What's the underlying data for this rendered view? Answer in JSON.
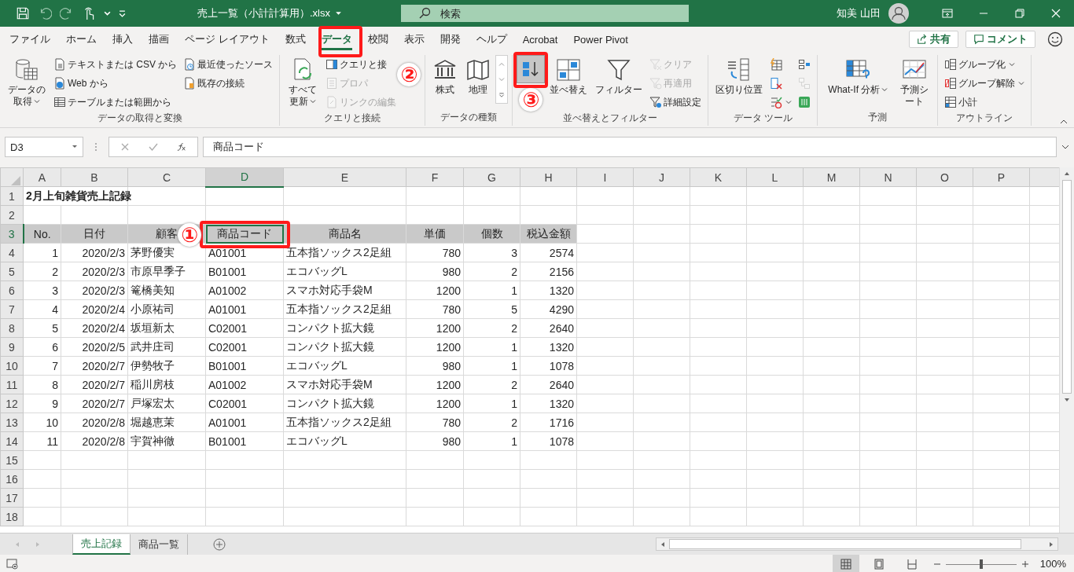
{
  "title_bar": {
    "file_name": "売上一覧（小計計算用）.xlsx",
    "search": {
      "placeholder": "検索"
    },
    "user_name": "知美 山田"
  },
  "menu_tabs": [
    {
      "label": "ファイル",
      "selected": false
    },
    {
      "label": "ホーム",
      "selected": false
    },
    {
      "label": "挿入",
      "selected": false
    },
    {
      "label": "描画",
      "selected": false
    },
    {
      "label": "ページ レイアウト",
      "selected": false
    },
    {
      "label": "数式",
      "selected": false
    },
    {
      "label": "データ",
      "selected": true
    },
    {
      "label": "校閲",
      "selected": false
    },
    {
      "label": "表示",
      "selected": false
    },
    {
      "label": "開発",
      "selected": false
    },
    {
      "label": "ヘルプ",
      "selected": false
    },
    {
      "label": "Acrobat",
      "selected": false
    },
    {
      "label": "Power Pivot",
      "selected": false
    }
  ],
  "share_button": "共有",
  "comment_button": "コメント",
  "ribbon_groups": [
    {
      "name": "データの取得と変換",
      "items": [
        {
          "label": "データの取得",
          "kind": "large",
          "dropdown": true,
          "disabled": false,
          "highlighted": false
        },
        {
          "label": "テキストまたは CSV から",
          "kind": "small",
          "dropdown": false,
          "disabled": false,
          "highlighted": false
        },
        {
          "label": "Web から",
          "kind": "small",
          "dropdown": false,
          "disabled": false,
          "highlighted": false
        },
        {
          "label": "テーブルまたは範囲から",
          "kind": "small",
          "dropdown": false,
          "disabled": false,
          "highlighted": false
        },
        {
          "label": "最近使ったソース",
          "kind": "small",
          "dropdown": false,
          "disabled": false,
          "highlighted": false
        },
        {
          "label": "既存の接続",
          "kind": "small",
          "dropdown": false,
          "disabled": false,
          "highlighted": false
        }
      ]
    },
    {
      "name": "クエリと接続",
      "items": [
        {
          "label": "すべて更新",
          "kind": "large",
          "dropdown": true,
          "disabled": false,
          "highlighted": false
        },
        {
          "label": "クエリと接",
          "kind": "small",
          "dropdown": false,
          "disabled": false,
          "highlighted": false
        },
        {
          "label": "プロパ",
          "kind": "small",
          "dropdown": false,
          "disabled": true,
          "highlighted": false
        },
        {
          "label": "リンクの編集",
          "kind": "small",
          "dropdown": false,
          "disabled": true,
          "highlighted": false
        }
      ]
    },
    {
      "name": "データの種類",
      "items": [
        {
          "label": "株式",
          "kind": "large",
          "dropdown": false,
          "disabled": false,
          "highlighted": false
        },
        {
          "label": "地理",
          "kind": "large",
          "dropdown": false,
          "disabled": false,
          "highlighted": false
        }
      ]
    },
    {
      "name": "並べ替えとフィルター",
      "items": [
        {
          "kind": "icon",
          "dropdown": false,
          "disabled": false,
          "highlighted": true
        },
        {
          "label": "並べ替え",
          "kind": "large",
          "dropdown": false,
          "disabled": false,
          "highlighted": false
        },
        {
          "label": "フィルター",
          "kind": "large",
          "dropdown": false,
          "disabled": false,
          "highlighted": false
        },
        {
          "label": "クリア",
          "kind": "small",
          "dropdown": false,
          "disabled": true,
          "highlighted": false
        },
        {
          "label": "再適用",
          "kind": "small",
          "dropdown": false,
          "disabled": true,
          "highlighted": false
        },
        {
          "label": "詳細設定",
          "kind": "small",
          "dropdown": false,
          "disabled": false,
          "highlighted": false
        }
      ]
    },
    {
      "name": "データ ツール",
      "items": [
        {
          "label": "区切り位置",
          "kind": "large",
          "dropdown": false,
          "disabled": false,
          "highlighted": false
        },
        {
          "kind": "icon",
          "dropdown": false,
          "disabled": false,
          "highlighted": false
        },
        {
          "kind": "icon",
          "dropdown": false,
          "disabled": false,
          "highlighted": false
        },
        {
          "kind": "icon",
          "dropdown": true,
          "disabled": false,
          "highlighted": false
        },
        {
          "kind": "icon",
          "dropdown": false,
          "disabled": false,
          "highlighted": false
        },
        {
          "kind": "icon",
          "dropdown": false,
          "disabled": true,
          "highlighted": false
        },
        {
          "kind": "icon",
          "dropdown": false,
          "disabled": false,
          "highlighted": false
        }
      ]
    },
    {
      "name": "予測",
      "items": [
        {
          "label": "What-If 分析",
          "kind": "large",
          "dropdown": true,
          "disabled": false,
          "highlighted": false
        },
        {
          "label": "予測シート",
          "kind": "large",
          "dropdown": false,
          "disabled": false,
          "highlighted": false
        }
      ]
    },
    {
      "name": "アウトライン",
      "items": [
        {
          "label": "グループ化",
          "kind": "small",
          "dropdown": true,
          "disabled": false,
          "highlighted": false
        },
        {
          "label": "グループ解除",
          "kind": "small",
          "dropdown": true,
          "disabled": false,
          "highlighted": false
        },
        {
          "label": "小計",
          "kind": "small",
          "dropdown": false,
          "disabled": false,
          "highlighted": false
        }
      ]
    }
  ],
  "formula_bar": {
    "name_box": "D3",
    "formula": "商品コード"
  },
  "sheet": {
    "columns": [
      {
        "label": "A",
        "selected": false
      },
      {
        "label": "B",
        "selected": false
      },
      {
        "label": "C",
        "selected": false
      },
      {
        "label": "D",
        "selected": true
      },
      {
        "label": "E",
        "selected": false
      },
      {
        "label": "F",
        "selected": false
      },
      {
        "label": "G",
        "selected": false
      },
      {
        "label": "H",
        "selected": false
      },
      {
        "label": "I",
        "selected": false
      },
      {
        "label": "J",
        "selected": false
      },
      {
        "label": "K",
        "selected": false
      },
      {
        "label": "L",
        "selected": false
      },
      {
        "label": "M",
        "selected": false
      },
      {
        "label": "N",
        "selected": false
      },
      {
        "label": "O",
        "selected": false
      },
      {
        "label": "P",
        "selected": false
      }
    ],
    "rows": [
      {
        "number": "1",
        "kind": "title",
        "selected": false,
        "cells": [
          "2月上旬雑貨売上記録"
        ]
      },
      {
        "number": "2",
        "kind": "empty",
        "selected": false,
        "cells": []
      },
      {
        "number": "3",
        "kind": "header",
        "selected": true,
        "cells": [
          "No.",
          "日付",
          "顧客",
          "商品コード",
          "商品名",
          "単価",
          "個数",
          "税込金額"
        ]
      },
      {
        "number": "4",
        "kind": "data",
        "selected": false,
        "cells": [
          "1",
          "2020/2/3",
          "茅野優実",
          "A01001",
          "五本指ソックス2足組",
          "780",
          "3",
          "2574"
        ]
      },
      {
        "number": "5",
        "kind": "data",
        "selected": false,
        "cells": [
          "2",
          "2020/2/3",
          "市原早季子",
          "B01001",
          "エコバッグL",
          "980",
          "2",
          "2156"
        ]
      },
      {
        "number": "6",
        "kind": "data",
        "selected": false,
        "cells": [
          "3",
          "2020/2/3",
          "篭橋美知",
          "A01002",
          "スマホ対応手袋M",
          "1200",
          "1",
          "1320"
        ]
      },
      {
        "number": "7",
        "kind": "data",
        "selected": false,
        "cells": [
          "4",
          "2020/2/4",
          "小原祐司",
          "A01001",
          "五本指ソックス2足組",
          "780",
          "5",
          "4290"
        ]
      },
      {
        "number": "8",
        "kind": "data",
        "selected": false,
        "cells": [
          "5",
          "2020/2/4",
          "坂垣新太",
          "C02001",
          "コンパクト拡大鏡",
          "1200",
          "2",
          "2640"
        ]
      },
      {
        "number": "9",
        "kind": "data",
        "selected": false,
        "cells": [
          "6",
          "2020/2/5",
          "武井庄司",
          "C02001",
          "コンパクト拡大鏡",
          "1200",
          "1",
          "1320"
        ]
      },
      {
        "number": "10",
        "kind": "data",
        "selected": false,
        "cells": [
          "7",
          "2020/2/7",
          "伊勢牧子",
          "B01001",
          "エコバッグL",
          "980",
          "1",
          "1078"
        ]
      },
      {
        "number": "11",
        "kind": "data",
        "selected": false,
        "cells": [
          "8",
          "2020/2/7",
          "稲川房枝",
          "A01002",
          "スマホ対応手袋M",
          "1200",
          "2",
          "2640"
        ]
      },
      {
        "number": "12",
        "kind": "data",
        "selected": false,
        "cells": [
          "9",
          "2020/2/7",
          "戸塚宏太",
          "C02001",
          "コンパクト拡大鏡",
          "1200",
          "1",
          "1320"
        ]
      },
      {
        "number": "13",
        "kind": "data",
        "selected": false,
        "cells": [
          "10",
          "2020/2/8",
          "堀越恵茉",
          "A01001",
          "五本指ソックス2足組",
          "780",
          "2",
          "1716"
        ]
      },
      {
        "number": "14",
        "kind": "data",
        "selected": false,
        "cells": [
          "11",
          "2020/2/8",
          "宇賀神徹",
          "B01001",
          "エコバッグL",
          "980",
          "1",
          "1078"
        ]
      },
      {
        "number": "15",
        "kind": "empty",
        "selected": false,
        "cells": []
      },
      {
        "number": "16",
        "kind": "empty",
        "selected": false,
        "cells": []
      },
      {
        "number": "17",
        "kind": "empty",
        "selected": false,
        "cells": []
      },
      {
        "number": "18",
        "kind": "empty",
        "selected": false,
        "cells": []
      }
    ]
  },
  "sheet_tabs": [
    {
      "label": "売上記録",
      "selected": true
    },
    {
      "label": "商品一覧",
      "selected": false
    }
  ],
  "status_bar": {
    "view_buttons": [
      {
        "selected": true
      },
      {
        "selected": false
      },
      {
        "selected": false
      }
    ],
    "zoom": {
      "level": 0.5,
      "reading": "100%"
    }
  },
  "annotations": [
    {
      "label": "①"
    },
    {
      "label": "②"
    },
    {
      "label": "③"
    }
  ]
}
